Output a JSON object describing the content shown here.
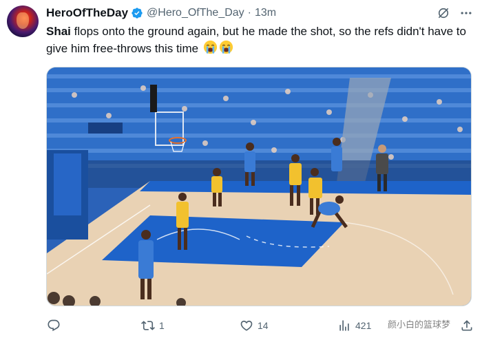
{
  "tweet": {
    "display_name": "HeroOfTheDay",
    "handle": "@Hero_OfThe_Day",
    "separator": "·",
    "time": "13m",
    "text_bold": "Shai",
    "text_rest": " flops onto the ground again, but he made the shot, so the refs didn't have to give him free-throws this time ",
    "emojis": [
      "loudly-crying-face",
      "loudly-crying-face"
    ]
  },
  "actions": {
    "reply_count": "",
    "retweet_count": "1",
    "like_count": "14",
    "views_count": "421"
  },
  "watermark": "颜小白的篮球梦",
  "colors": {
    "verified": "#1d9bf0",
    "court_paint": "#1e63c9",
    "court_floor": "#e9d2b4",
    "crowd": "#2f6fc8",
    "lakers_jersey": "#f2c12e",
    "thunder_jersey": "#3a7bd5"
  }
}
